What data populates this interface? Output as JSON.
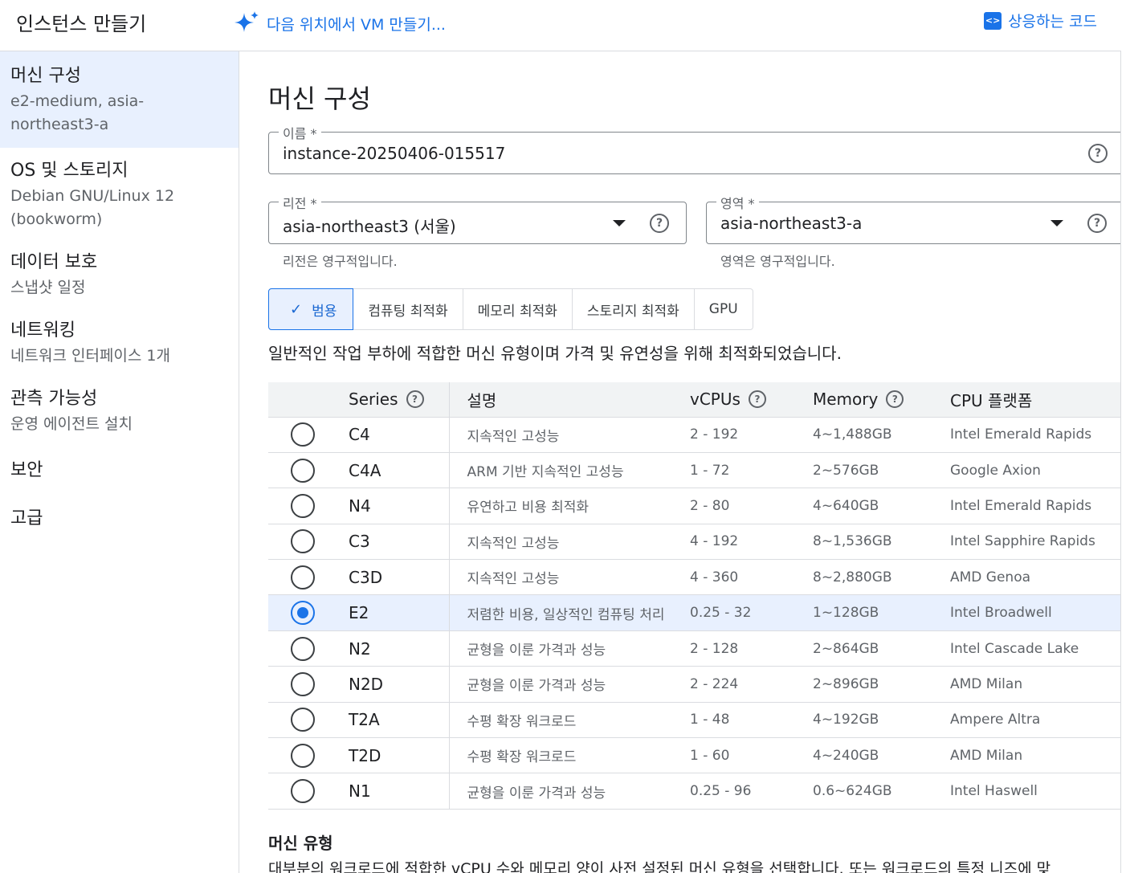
{
  "header": {
    "title": "인스턴스 만들기",
    "gemini_link": "다음 위치에서 VM 만들기...",
    "equiv_code": "상응하는 코드",
    "code_icon_glyph": "<>"
  },
  "sidebar": {
    "items": [
      {
        "label": "머신 구성",
        "sub": "e2-medium, asia-northeast3-a"
      },
      {
        "label": "OS 및 스토리지",
        "sub": "Debian GNU/Linux 12 (bookworm)"
      },
      {
        "label": "데이터 보호",
        "sub": "스냅샷 일정"
      },
      {
        "label": "네트워킹",
        "sub": "네트워크 인터페이스 1개"
      },
      {
        "label": "관측 가능성",
        "sub": "운영 에이전트 설치"
      },
      {
        "label": "보안",
        "sub": ""
      },
      {
        "label": "고급",
        "sub": ""
      }
    ]
  },
  "main": {
    "title": "머신 구성",
    "name_field": {
      "label": "이름 *",
      "value": "instance-20250406-015517"
    },
    "region_field": {
      "label": "리전 *",
      "value": "asia-northeast3 (서울)",
      "hint": "리전은 영구적입니다."
    },
    "zone_field": {
      "label": "영역 *",
      "value": "asia-northeast3-a",
      "hint": "영역은 영구적입니다."
    },
    "help_glyph": "?",
    "check_glyph": "✓",
    "chips": [
      "범용",
      "컴퓨팅 최적화",
      "메모리 최적화",
      "스토리지 최적화",
      "GPU"
    ],
    "category_desc": "일반적인 작업 부하에 적합한 머신 유형이며 가격 및 유연성을 위해 최적화되었습니다.",
    "table": {
      "headers": {
        "series": "Series",
        "desc": "설명",
        "vcpus": "vCPUs",
        "memory": "Memory",
        "platform": "CPU 플랫폼"
      },
      "rows": [
        {
          "series": "C4",
          "desc": "지속적인 고성능",
          "vcpus": "2 - 192",
          "memory": "4~1,488GB",
          "platform": "Intel Emerald Rapids",
          "selected": false
        },
        {
          "series": "C4A",
          "desc": "ARM 기반 지속적인 고성능",
          "vcpus": "1 - 72",
          "memory": "2~576GB",
          "platform": "Google Axion",
          "selected": false
        },
        {
          "series": "N4",
          "desc": "유연하고 비용 최적화",
          "vcpus": "2 - 80",
          "memory": "4~640GB",
          "platform": "Intel Emerald Rapids",
          "selected": false
        },
        {
          "series": "C3",
          "desc": "지속적인 고성능",
          "vcpus": "4 - 192",
          "memory": "8~1,536GB",
          "platform": "Intel Sapphire Rapids",
          "selected": false
        },
        {
          "series": "C3D",
          "desc": "지속적인 고성능",
          "vcpus": "4 - 360",
          "memory": "8~2,880GB",
          "platform": "AMD Genoa",
          "selected": false
        },
        {
          "series": "E2",
          "desc": "저렴한 비용, 일상적인 컴퓨팅 처리",
          "vcpus": "0.25 - 32",
          "memory": "1~128GB",
          "platform": "Intel Broadwell",
          "selected": true
        },
        {
          "series": "N2",
          "desc": "균형을 이룬 가격과 성능",
          "vcpus": "2 - 128",
          "memory": "2~864GB",
          "platform": "Intel Cascade Lake",
          "selected": false
        },
        {
          "series": "N2D",
          "desc": "균형을 이룬 가격과 성능",
          "vcpus": "2 - 224",
          "memory": "2~896GB",
          "platform": "AMD Milan",
          "selected": false
        },
        {
          "series": "T2A",
          "desc": "수평 확장 워크로드",
          "vcpus": "1 - 48",
          "memory": "4~192GB",
          "platform": "Ampere Altra",
          "selected": false
        },
        {
          "series": "T2D",
          "desc": "수평 확장 워크로드",
          "vcpus": "1 - 60",
          "memory": "4~240GB",
          "platform": "AMD Milan",
          "selected": false
        },
        {
          "series": "N1",
          "desc": "균형을 이룬 가격과 성능",
          "vcpus": "0.25 - 96",
          "memory": "0.6~624GB",
          "platform": "Intel Haswell",
          "selected": false
        }
      ]
    },
    "machine_type_title": "머신 유형",
    "machine_type_desc": "대부분의 워크로드에 적합한 vCPU 수와 메모리 양이 사전 설정된 머신 유형을 선택합니다. 또는 워크로드의 특정 니즈에 맞"
  },
  "colors": {
    "accent": "#1a73e8",
    "selected_bg": "#e8f0fe",
    "header_bg": "#f1f3f4"
  }
}
